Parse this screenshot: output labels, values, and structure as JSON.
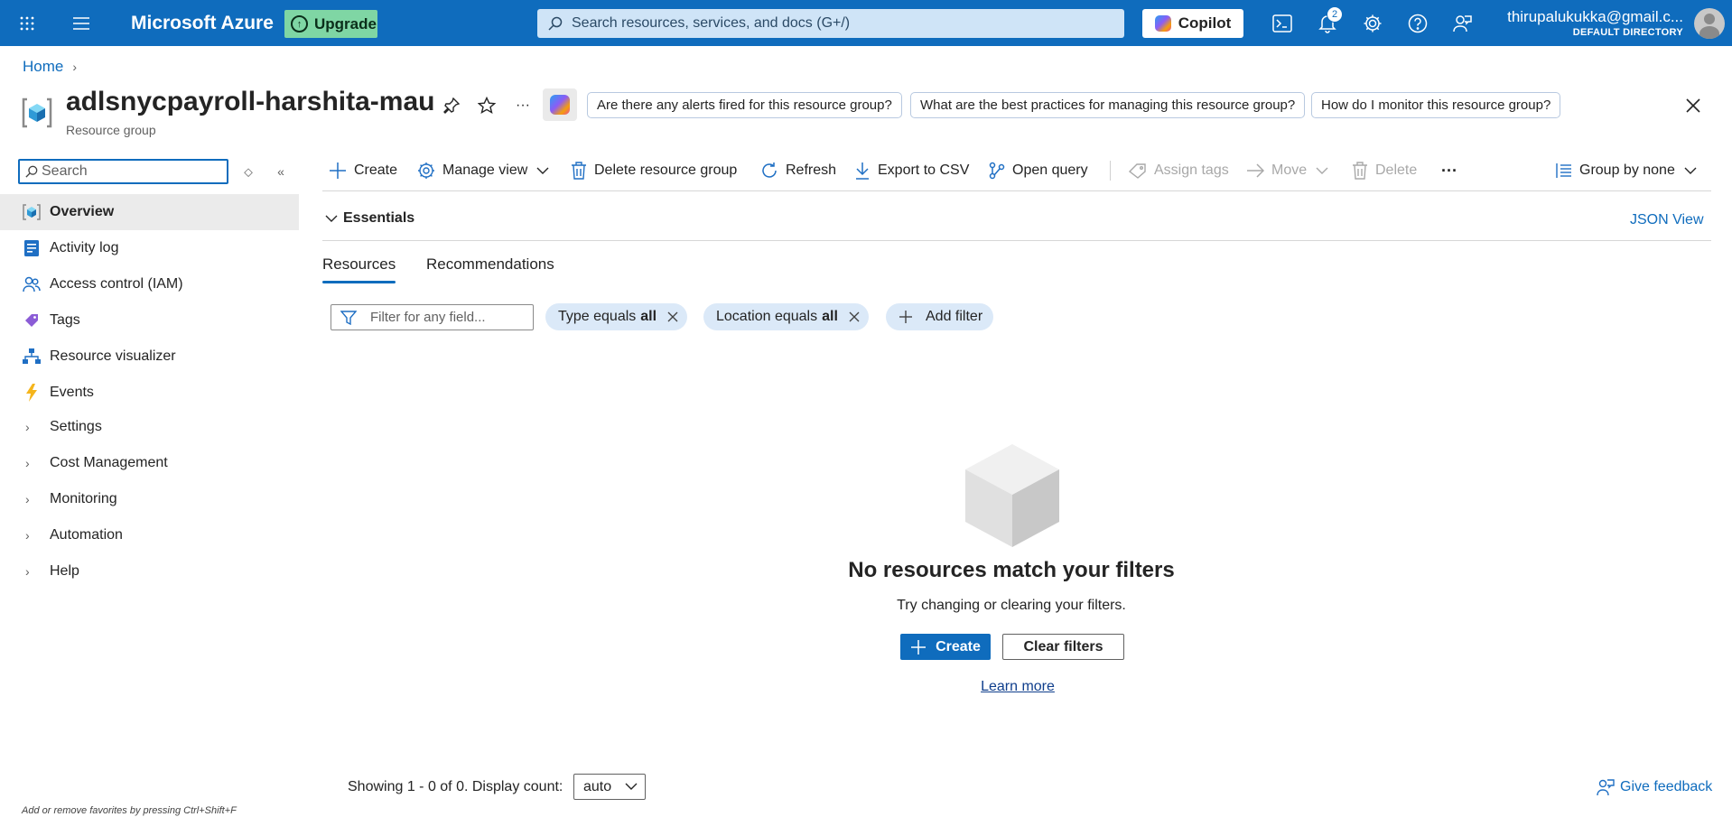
{
  "topbar": {
    "brand": "Microsoft Azure",
    "upgrade_label": "Upgrade",
    "search_placeholder": "Search resources, services, and docs (G+/)",
    "copilot_label": "Copilot",
    "notification_count": "2",
    "user_email": "thirupalukukka@gmail.c...",
    "directory": "DEFAULT DIRECTORY"
  },
  "breadcrumb": {
    "home": "Home"
  },
  "header": {
    "title": "adlsnycpayroll-harshita-mau",
    "subtitle": "Resource group",
    "more": "···",
    "prompts": [
      "Are there any alerts fired for this resource group?",
      "What are the best practices for managing this resource group?",
      "How do I monitor this resource group?"
    ]
  },
  "sidebar": {
    "search_placeholder": "Search",
    "items": [
      {
        "label": "Overview",
        "icon": "resource-group-icon"
      },
      {
        "label": "Activity log",
        "icon": "activity-log-icon"
      },
      {
        "label": "Access control (IAM)",
        "icon": "people-icon"
      },
      {
        "label": "Tags",
        "icon": "tag-icon"
      },
      {
        "label": "Resource visualizer",
        "icon": "hierarchy-icon"
      },
      {
        "label": "Events",
        "icon": "lightning-icon"
      }
    ],
    "groups": [
      "Settings",
      "Cost Management",
      "Monitoring",
      "Automation",
      "Help"
    ],
    "favorites_hint": "Add or remove favorites by pressing Ctrl+Shift+F"
  },
  "commandbar": {
    "create": "Create",
    "manage_view": "Manage view",
    "delete_rg": "Delete resource group",
    "refresh": "Refresh",
    "export_csv": "Export to CSV",
    "open_query": "Open query",
    "assign_tags": "Assign tags",
    "move": "Move",
    "delete": "Delete",
    "more": "···",
    "group_by": "Group by none"
  },
  "essentials": {
    "label": "Essentials",
    "json_view": "JSON View"
  },
  "tabs": [
    "Resources",
    "Recommendations"
  ],
  "filters": {
    "placeholder": "Filter for any field...",
    "type_prefix": "Type equals",
    "type_value": "all",
    "location_prefix": "Location equals",
    "location_value": "all",
    "add_filter": "Add filter"
  },
  "empty_state": {
    "title": "No resources match your filters",
    "subtitle": "Try changing or clearing your filters.",
    "create": "Create",
    "clear_filters": "Clear filters",
    "learn_more": "Learn more"
  },
  "footer": {
    "showing": "Showing 1 - 0 of 0. Display count:",
    "display_count": "auto",
    "feedback": "Give feedback"
  },
  "colors": {
    "accent": "#0f6cbd",
    "topbar": "#0f6cbd",
    "upgrade": "#7fd6a4",
    "pill": "#dbe9f8"
  }
}
